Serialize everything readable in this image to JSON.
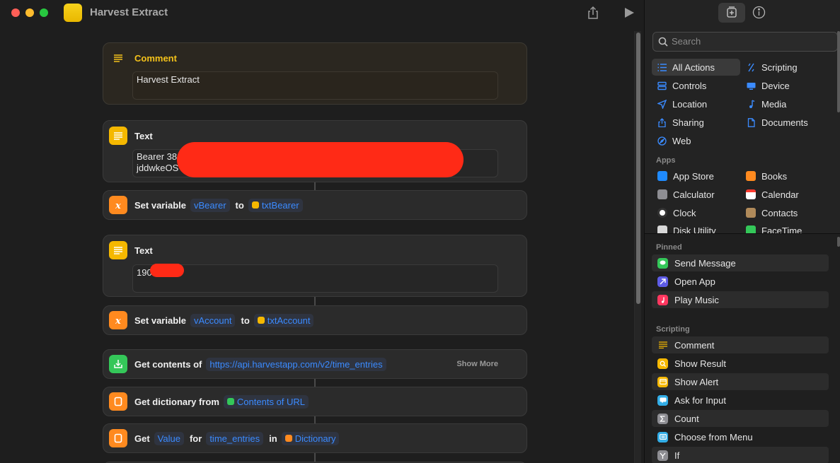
{
  "window": {
    "title": "Harvest Extract"
  },
  "cards": {
    "comment": {
      "title": "Comment",
      "body": "Harvest Extract"
    },
    "text1": {
      "title": "Text",
      "line1": "Bearer 38",
      "line2": "jddwkeOS"
    },
    "setvar1": {
      "title": "Set variable",
      "var": "vBearer",
      "to": "to",
      "value": "txtBearer"
    },
    "text2": {
      "title": "Text",
      "body": "190"
    },
    "setvar2": {
      "title": "Set variable",
      "var": "vAccount",
      "to": "to",
      "value": "txtAccount"
    },
    "getcontents": {
      "title": "Get contents of",
      "url": "https://api.harvestapp.com/v2/time_entries",
      "more": "Show More"
    },
    "getdict": {
      "title": "Get dictionary from",
      "source": "Contents of URL"
    },
    "getvalue": {
      "title": "Get",
      "what": "Value",
      "for_word": "for",
      "key": "time_entries",
      "in_word": "in",
      "dict": "Dictionary"
    }
  },
  "panel": {
    "search_placeholder": "Search",
    "categories": [
      {
        "label": "All Actions",
        "icon": "list-icon"
      },
      {
        "label": "Scripting",
        "icon": "scripting-icon"
      },
      {
        "label": "Controls",
        "icon": "controls-icon"
      },
      {
        "label": "Device",
        "icon": "device-icon"
      },
      {
        "label": "Location",
        "icon": "location-icon"
      },
      {
        "label": "Media",
        "icon": "music-note-icon"
      },
      {
        "label": "Sharing",
        "icon": "share-icon"
      },
      {
        "label": "Documents",
        "icon": "document-icon"
      },
      {
        "label": "Web",
        "icon": "compass-icon"
      }
    ],
    "apps_label": "Apps",
    "apps": [
      {
        "label": "App Store",
        "color": "#1f8bff"
      },
      {
        "label": "Books",
        "color": "#ff8a1f"
      },
      {
        "label": "Calculator",
        "color": "#8e8e93"
      },
      {
        "label": "Calendar",
        "color": "#ffffff"
      },
      {
        "label": "Clock",
        "color": "#ffffff"
      },
      {
        "label": "Contacts",
        "color": "#b08a5a"
      },
      {
        "label": "Disk Utility",
        "color": "#d8d8d8"
      },
      {
        "label": "FaceTime",
        "color": "#34c759"
      }
    ],
    "pinned_label": "Pinned",
    "pinned": [
      {
        "label": "Send Message",
        "color": "#34c759"
      },
      {
        "label": "Open App",
        "color": "#5e5ce6"
      },
      {
        "label": "Play Music",
        "color": "#ff375f"
      }
    ],
    "scripting_label": "Scripting",
    "scripting": [
      {
        "label": "Comment",
        "color": "#f5b800"
      },
      {
        "label": "Show Result",
        "color": "#f5b800"
      },
      {
        "label": "Show Alert",
        "color": "#f5b800"
      },
      {
        "label": "Ask for Input",
        "color": "#32ade6"
      },
      {
        "label": "Count",
        "color": "#8e8e93"
      },
      {
        "label": "Choose from Menu",
        "color": "#32ade6"
      },
      {
        "label": "If",
        "color": "#8e8e93"
      }
    ]
  }
}
